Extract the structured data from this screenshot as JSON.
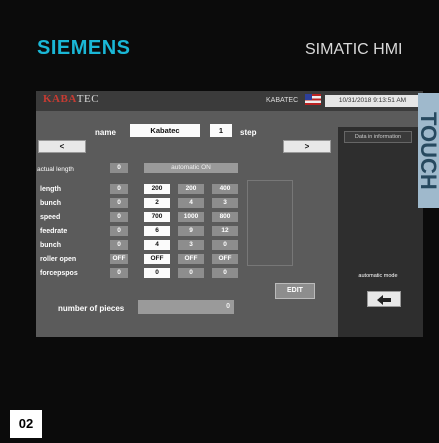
{
  "header": {
    "brand": "SIEMENS",
    "product": "SIMATIC HMI"
  },
  "hmi": {
    "logo_a": "KABA",
    "logo_b": "TEC",
    "station": "KABATEC",
    "datetime": "10/31/2018 9:13:51 AM",
    "side_tab": "TOUCH",
    "name_label": "name",
    "name_value": "Kabatec",
    "step_value": "1",
    "step_label": "step",
    "prev_label": "<",
    "next_label": ">",
    "actual_length_label": "actual length",
    "actual_length_value": "0",
    "automatic_button": "automatic ON",
    "rows": [
      {
        "label": "length",
        "values": [
          "0",
          "200",
          "200",
          "400"
        ]
      },
      {
        "label": "bunch",
        "values": [
          "0",
          "2",
          "4",
          "3"
        ]
      },
      {
        "label": "speed",
        "values": [
          "0",
          "700",
          "1000",
          "800"
        ]
      },
      {
        "label": "feedrate",
        "values": [
          "0",
          "6",
          "9",
          "12"
        ]
      },
      {
        "label": "bunch",
        "values": [
          "0",
          "4",
          "3",
          "0"
        ]
      },
      {
        "label": "roller open",
        "values": [
          "OFF",
          "OFF",
          "OFF",
          "OFF"
        ]
      },
      {
        "label": "forcepspos",
        "values": [
          "0",
          "0",
          "0",
          "0"
        ]
      }
    ],
    "edit_label": "EDIT",
    "pieces_label": "number of pieces",
    "pieces_value": "0",
    "data_info_button": "Data in information",
    "automatic_mode_label": "automatic mode",
    "back_icon": "back-arrow-icon"
  },
  "footer": {
    "page_number": "02"
  }
}
